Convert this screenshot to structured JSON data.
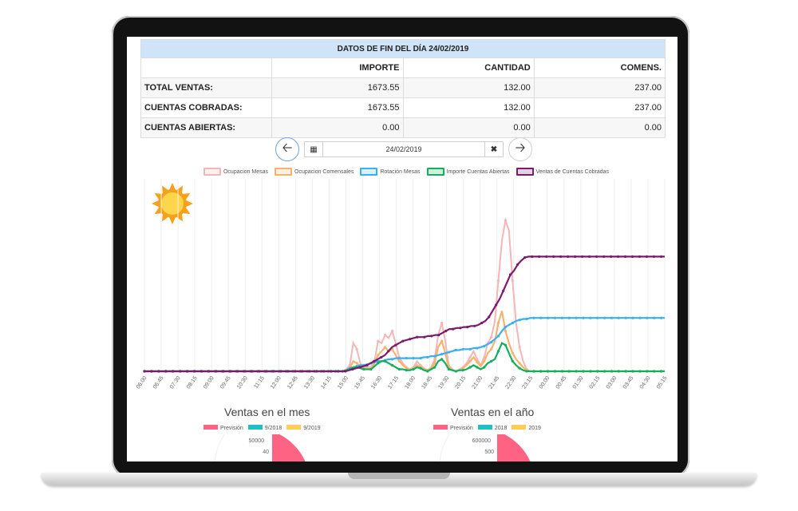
{
  "table": {
    "title": "DATOS DE FIN DEL DÍA 24/02/2019",
    "columns": [
      "IMPORTE",
      "CANTIDAD",
      "COMENS."
    ],
    "rows": [
      {
        "label": "TOTAL VENTAS:",
        "importe": "1673.55",
        "cantidad": "132.00",
        "comens": "237.00"
      },
      {
        "label": "CUENTAS COBRADAS:",
        "importe": "1673.55",
        "cantidad": "132.00",
        "comens": "237.00"
      },
      {
        "label": "CUENTAS ABIERTAS:",
        "importe": "0.00",
        "cantidad": "0.00",
        "comens": "0.00"
      }
    ]
  },
  "date_picker": {
    "value": "24/02/2019",
    "prev_icon": "arrow-left-icon",
    "next_icon": "arrow-right-icon",
    "calendar_icon": "calendar-icon",
    "clear_icon": "close-icon"
  },
  "weather_icon": "sun-icon",
  "chart_data": {
    "type": "line",
    "legend": [
      {
        "name": "Ocupacion Mesas",
        "color": "#f4b6b6"
      },
      {
        "name": "Ocupacion Comensales",
        "color": "#f5b36e"
      },
      {
        "name": "Rotación Mesas",
        "color": "#3ab0ef"
      },
      {
        "name": "Importe Cuentas Abiertas",
        "color": "#13b05b"
      },
      {
        "name": "Ventas de Cuentas Cobradas",
        "color": "#7a1b6e"
      }
    ],
    "x_ticks": [
      "06:00",
      "06:45",
      "07:30",
      "08:15",
      "09:00",
      "09:45",
      "10:30",
      "11:15",
      "12:00",
      "12:45",
      "13:30",
      "14:15",
      "15:00",
      "15:45",
      "16:30",
      "17:15",
      "18:00",
      "18:45",
      "19:30",
      "20:15",
      "21:00",
      "21:45",
      "22:30",
      "23:15",
      "00:00",
      "00:45",
      "01:30",
      "02:15",
      "03:00",
      "03:45",
      "04:30",
      "05:15"
    ],
    "series": [
      {
        "name": "Ocupacion Mesas",
        "color": "#f4b6b6",
        "values": [
          0,
          0,
          0,
          0,
          0,
          0,
          0,
          0,
          0,
          0,
          0,
          0,
          0,
          0,
          0,
          0,
          0,
          0,
          0,
          0,
          0,
          0,
          0,
          0,
          0,
          0,
          0,
          0,
          0,
          0,
          0,
          0,
          0,
          0,
          0,
          0,
          0,
          0,
          0,
          0,
          0,
          0,
          0,
          0,
          0,
          0,
          0,
          0,
          0,
          0,
          0,
          0,
          0,
          0,
          0,
          0,
          0,
          2,
          6,
          28,
          22,
          8,
          3,
          5,
          4,
          10,
          30,
          28,
          36,
          33,
          40,
          28,
          14,
          8,
          4,
          2,
          4,
          10,
          6,
          3,
          1,
          4,
          12,
          36,
          48,
          30,
          6,
          2,
          0,
          2,
          4,
          8,
          14,
          20,
          12,
          6,
          14,
          28,
          34,
          50,
          90,
          130,
          150,
          140,
          90,
          48,
          24,
          10,
          2,
          0,
          0,
          0,
          0,
          0,
          0,
          0,
          0,
          0,
          0,
          0,
          0,
          0,
          0,
          0,
          0,
          0,
          0,
          0,
          0,
          0,
          0,
          0,
          0,
          0,
          0,
          0,
          0,
          0,
          0,
          0,
          0,
          0,
          0,
          0,
          0,
          0,
          0,
          0
        ]
      },
      {
        "name": "Ocupacion Comensales",
        "color": "#f5b36e",
        "values": [
          0,
          0,
          0,
          0,
          0,
          0,
          0,
          0,
          0,
          0,
          0,
          0,
          0,
          0,
          0,
          0,
          0,
          0,
          0,
          0,
          0,
          0,
          0,
          0,
          0,
          0,
          0,
          0,
          0,
          0,
          0,
          0,
          0,
          0,
          0,
          0,
          0,
          0,
          0,
          0,
          0,
          0,
          0,
          0,
          0,
          0,
          0,
          0,
          0,
          0,
          0,
          0,
          0,
          0,
          0,
          0,
          0,
          1,
          3,
          10,
          8,
          5,
          2,
          3,
          2,
          8,
          16,
          20,
          24,
          20,
          22,
          16,
          10,
          6,
          3,
          1,
          3,
          6,
          4,
          2,
          1,
          3,
          8,
          24,
          30,
          18,
          4,
          1,
          0,
          1,
          3,
          6,
          10,
          14,
          9,
          5,
          10,
          18,
          22,
          30,
          48,
          60,
          40,
          28,
          18,
          12,
          8,
          4,
          1,
          0,
          0,
          0,
          0,
          0,
          0,
          0,
          0,
          0,
          0,
          0,
          0,
          0,
          0,
          0,
          0,
          0,
          0,
          0,
          0,
          0,
          0,
          0,
          0,
          0,
          0,
          0,
          0,
          0,
          0,
          0,
          0,
          0,
          0,
          0,
          0,
          0,
          0,
          0
        ]
      },
      {
        "name": "Rotación Mesas",
        "color": "#3ab0ef",
        "values": [
          0,
          0,
          0,
          0,
          0,
          0,
          0,
          0,
          0,
          0,
          0,
          0,
          0,
          0,
          0,
          0,
          0,
          0,
          0,
          0,
          0,
          0,
          0,
          0,
          0,
          0,
          0,
          0,
          0,
          0,
          0,
          0,
          0,
          0,
          0,
          0,
          0,
          0,
          0,
          0,
          0,
          0,
          0,
          0,
          0,
          0,
          0,
          0,
          0,
          0,
          0,
          0,
          0,
          0,
          0,
          0,
          0,
          1,
          3,
          4,
          5,
          6,
          6,
          7,
          8,
          9,
          10,
          10,
          11,
          12,
          12,
          13,
          13,
          13,
          13,
          13,
          13,
          13,
          13,
          14,
          14,
          15,
          15,
          16,
          17,
          18,
          19,
          20,
          21,
          21,
          22,
          22,
          22,
          23,
          23,
          24,
          25,
          27,
          29,
          32,
          35,
          40,
          44,
          46,
          48,
          50,
          51,
          52,
          52,
          53,
          53,
          53,
          53,
          53,
          53,
          53,
          53,
          53,
          53,
          53,
          53,
          53,
          53,
          53,
          53,
          53,
          53,
          53,
          53,
          53,
          53,
          53,
          53,
          53,
          53,
          53,
          53,
          53,
          53,
          53,
          53,
          53,
          53,
          53,
          53,
          53,
          53,
          53
        ]
      },
      {
        "name": "Importe Cuentas Abiertas",
        "color": "#13b05b",
        "values": [
          0,
          0,
          0,
          0,
          0,
          0,
          0,
          0,
          0,
          0,
          0,
          0,
          0,
          0,
          0,
          0,
          0,
          0,
          0,
          0,
          0,
          0,
          0,
          0,
          0,
          0,
          0,
          0,
          0,
          0,
          0,
          0,
          0,
          0,
          0,
          0,
          0,
          0,
          0,
          0,
          0,
          0,
          0,
          0,
          0,
          0,
          0,
          0,
          0,
          0,
          0,
          0,
          0,
          0,
          0,
          0,
          0,
          1,
          2,
          4,
          4,
          3,
          2,
          2,
          2,
          5,
          8,
          10,
          10,
          8,
          6,
          4,
          2,
          2,
          1,
          1,
          2,
          4,
          3,
          1,
          0,
          2,
          4,
          10,
          12,
          8,
          2,
          1,
          0,
          1,
          1,
          2,
          4,
          6,
          4,
          2,
          4,
          8,
          10,
          12,
          20,
          28,
          26,
          18,
          10,
          6,
          3,
          1,
          0,
          0,
          0,
          0,
          0,
          0,
          0,
          0,
          0,
          0,
          0,
          0,
          0,
          0,
          0,
          0,
          0,
          0,
          0,
          0,
          0,
          0,
          0,
          0,
          0,
          0,
          0,
          0,
          0,
          0,
          0,
          0,
          0,
          0,
          0,
          0,
          0,
          0,
          0,
          0
        ]
      },
      {
        "name": "Ventas de Cuentas Cobradas",
        "color": "#7a1b6e",
        "values": [
          0,
          0,
          0,
          0,
          0,
          0,
          0,
          0,
          0,
          0,
          0,
          0,
          0,
          0,
          0,
          0,
          0,
          0,
          0,
          0,
          0,
          0,
          0,
          0,
          0,
          0,
          0,
          0,
          0,
          0,
          0,
          0,
          0,
          0,
          0,
          0,
          0,
          0,
          0,
          0,
          0,
          0,
          0,
          0,
          0,
          0,
          0,
          0,
          0,
          0,
          0,
          0,
          0,
          0,
          0,
          0,
          0,
          1,
          2,
          3,
          4,
          5,
          6,
          8,
          10,
          12,
          14,
          16,
          20,
          24,
          26,
          28,
          30,
          31,
          32,
          33,
          34,
          34,
          34,
          35,
          35,
          36,
          36,
          38,
          40,
          42,
          42,
          43,
          43,
          44,
          44,
          45,
          45,
          46,
          48,
          50,
          54,
          60,
          66,
          72,
          80,
          88,
          96,
          100,
          106,
          110,
          113,
          114,
          114,
          114,
          114,
          114,
          114,
          114,
          114,
          114,
          114,
          114,
          114,
          114,
          114,
          114,
          114,
          114,
          114,
          114,
          114,
          114,
          114,
          114,
          114,
          114,
          114,
          114,
          114,
          114,
          114,
          114,
          114,
          114,
          114,
          114,
          114,
          114,
          114,
          114
        ]
      }
    ]
  },
  "mes": {
    "title": "Ventas en el mes",
    "legend": [
      {
        "name": "Previsión",
        "color": "#ff6384"
      },
      {
        "name": "9/2018",
        "color": "#1ec2c0"
      },
      {
        "name": "9/2019",
        "color": "#ffcd56"
      }
    ],
    "tick_top": "50000",
    "tick_second": "40"
  },
  "anio": {
    "title": "Ventas en el año",
    "legend": [
      {
        "name": "Previsión",
        "color": "#ff6384"
      },
      {
        "name": "2018",
        "color": "#1ec2c0"
      },
      {
        "name": "2019",
        "color": "#ffcd56"
      }
    ],
    "tick_top": "600000",
    "tick_second": "500"
  }
}
